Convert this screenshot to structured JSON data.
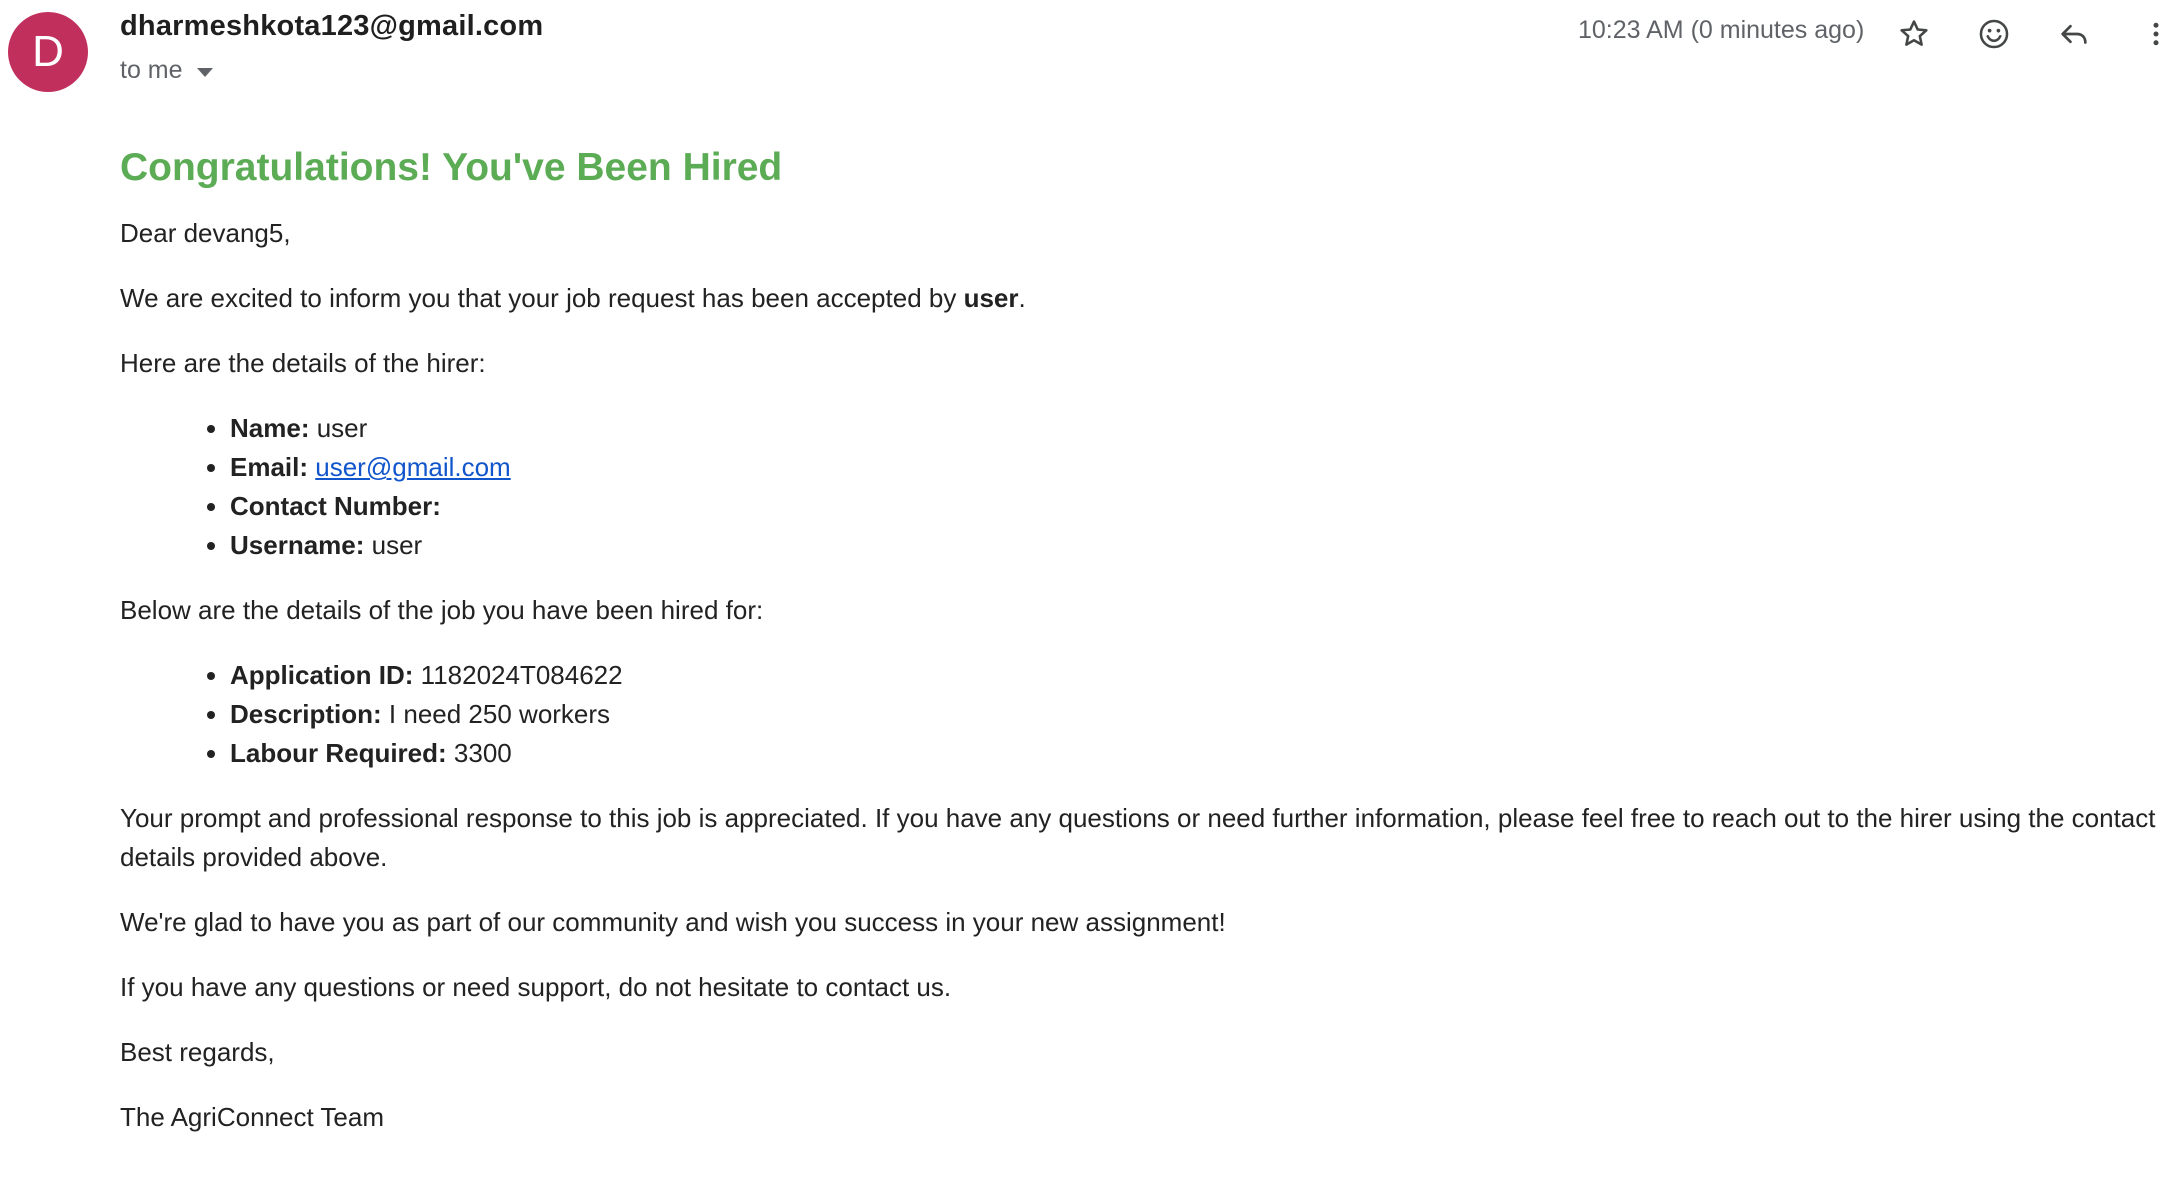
{
  "header": {
    "avatar_letter": "D",
    "avatar_color": "#c1305d",
    "sender": "dharmeshkota123@gmail.com",
    "recipient": "to me",
    "time": "10:23 AM (0 minutes ago)",
    "icons": [
      "star-icon",
      "emoji-icon",
      "reply-icon",
      "more-vert-icon"
    ]
  },
  "email": {
    "title": "Congratulations! You've Been Hired",
    "title_color": "#5cac56",
    "greeting": "Dear devang5,",
    "intro_prefix": "We are excited to inform you that your job request has been accepted by ",
    "intro_hirer": "user",
    "intro_suffix": ".",
    "hirer_heading": "Here are the details of the hirer:",
    "hirer": [
      {
        "label": "Name:",
        "value": "user"
      },
      {
        "label": "Email:",
        "value": "user@gmail.com"
      },
      {
        "label": "Contact Number:",
        "value": ""
      },
      {
        "label": "Username:",
        "value": "user"
      }
    ],
    "job_heading": "Below are the details of the job you have been hired for:",
    "job": [
      {
        "label": "Application ID:",
        "value": "1182024T084622"
      },
      {
        "label": "Description:",
        "value": "I need 250 workers"
      },
      {
        "label": "Labour Required:",
        "value": "3300"
      }
    ],
    "paragraph_prompt": "Your prompt and professional response to this job is appreciated. If you have any questions or need further information, please feel free to reach out to the hirer using the contact details provided above.",
    "paragraph_glad": "We're glad to have you as part of our community and wish you success in your new assignment!",
    "paragraph_support": "If you have any questions or need support, do not hesitate to contact us.",
    "signoff": "Best regards,",
    "signature": "The AgriConnect Team"
  }
}
